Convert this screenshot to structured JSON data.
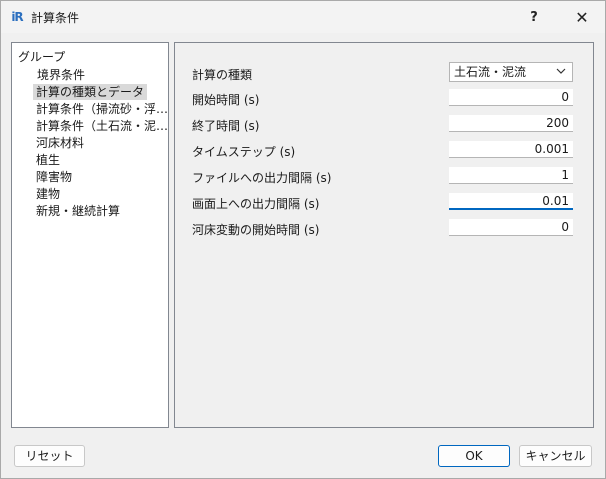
{
  "window": {
    "title": "計算条件",
    "help_label": "?",
    "close_label": "✕",
    "app_icon_text": "iR"
  },
  "group_panel": {
    "header": "グループ",
    "items": [
      {
        "label": "境界条件",
        "selected": false
      },
      {
        "label": "計算の種類とデータ",
        "selected": true
      },
      {
        "label": "計算条件（掃流砂・浮…",
        "selected": false
      },
      {
        "label": "計算条件（土石流・泥…",
        "selected": false
      },
      {
        "label": "河床材料",
        "selected": false
      },
      {
        "label": "植生",
        "selected": false
      },
      {
        "label": "障害物",
        "selected": false
      },
      {
        "label": "建物",
        "selected": false
      },
      {
        "label": "新規・継続計算",
        "selected": false
      }
    ]
  },
  "settings": {
    "calc_type": {
      "label": "計算の種類",
      "value": "土石流・泥流"
    },
    "start_time": {
      "label": "開始時間 (s)",
      "value": "0"
    },
    "end_time": {
      "label": "終了時間 (s)",
      "value": "200"
    },
    "time_step": {
      "label": "タイムステップ (s)",
      "value": "0.001"
    },
    "file_output_interval": {
      "label": "ファイルへの出力間隔 (s)",
      "value": "1"
    },
    "screen_output_interval": {
      "label": "画面上への出力間隔 (s)",
      "value": "0.01"
    },
    "bed_change_start": {
      "label": "河床変動の開始時間 (s)",
      "value": "0"
    }
  },
  "buttons": {
    "reset": "リセット",
    "ok": "OK",
    "cancel": "キャンセル"
  }
}
